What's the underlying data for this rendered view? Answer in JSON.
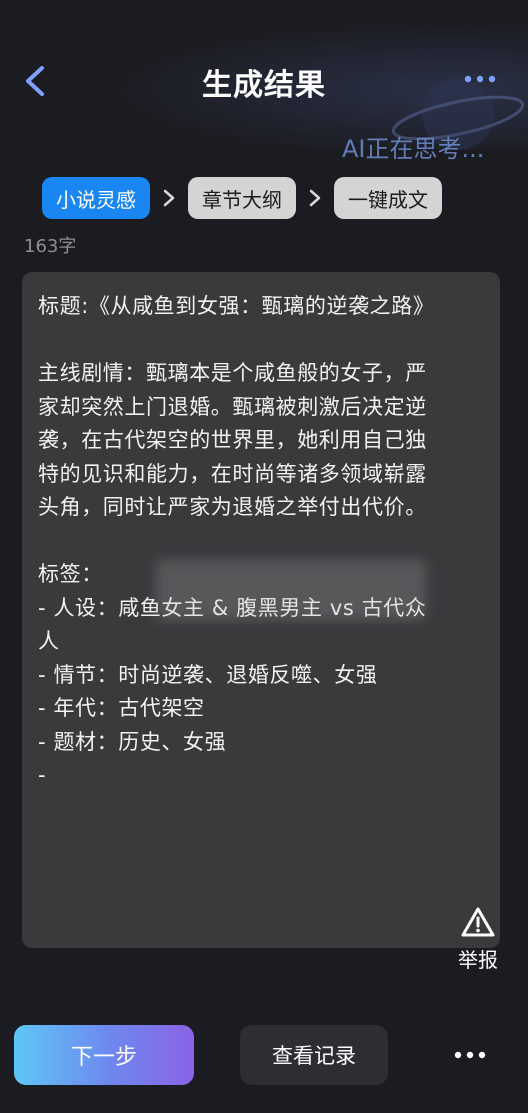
{
  "header": {
    "title": "生成结果",
    "thinking_text": "AI正在思考..."
  },
  "steps": [
    {
      "label": "小说灵感",
      "active": true
    },
    {
      "label": "章节大纲",
      "active": false
    },
    {
      "label": "一键成文",
      "active": false
    }
  ],
  "word_count": "163字",
  "content": {
    "title_line": "标题:《从咸鱼到女强：甄璃的逆袭之路》",
    "plot_lines": [
      "主线剧情：甄璃本是个咸鱼般的女子，严",
      "家却突然上门退婚。甄璃被刺激后决定逆",
      "袭，在古代架空的世界里，她利用自己独",
      "特的见识和能力，在时尚等诸多领域崭露",
      "头角，同时让严家为退婚之举付出代价。"
    ],
    "tags_header": "标签：",
    "tag_lines": [
      "- 人设：咸鱼女主 & 腹黑男主 vs 古代众",
      "人",
      "- 情节：时尚逆袭、退婚反噬、女强",
      "- 年代：古代架空",
      "- 题材：历史、女强",
      "-"
    ]
  },
  "report_label": "举报",
  "buttons": {
    "next": "下一步",
    "history": "查看记录"
  },
  "icons": {
    "back": "back-arrow-icon",
    "more": "more-dots-icon",
    "report": "warning-triangle-icon",
    "chevron": "chevron-right-icon",
    "accent_color": "#1a86f2"
  }
}
